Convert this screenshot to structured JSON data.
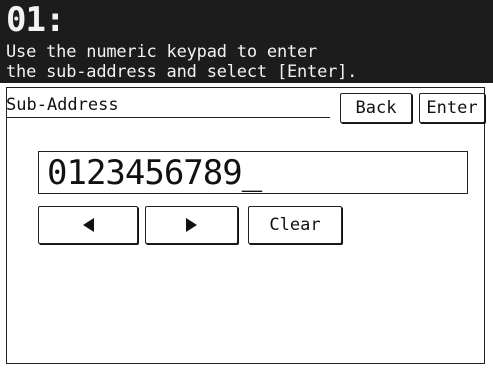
{
  "header": {
    "title": "01:",
    "instruction_line1": "Use the numeric keypad to enter",
    "instruction_line2": "the sub-address and select [Enter]."
  },
  "form": {
    "section_label": "Sub-Address",
    "value": "0123456789_",
    "buttons": {
      "back": "Back",
      "enter": "Enter",
      "clear": "Clear"
    }
  },
  "icons": {
    "left": "left-arrow-icon",
    "right": "right-arrow-icon"
  }
}
